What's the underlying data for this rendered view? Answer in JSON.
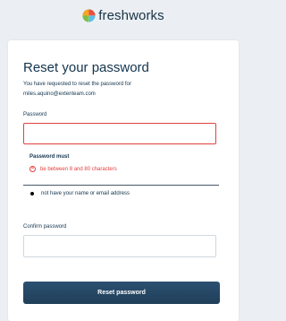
{
  "brand": {
    "name": "freshworks",
    "colors": [
      "#f5a623",
      "#e94e3d",
      "#2aa8e0",
      "#7cbf42"
    ]
  },
  "card": {
    "title": "Reset your password",
    "subtitle_line1": "You have requested to reset the password for",
    "subtitle_line2": "miles.aquino@extenteam.com"
  },
  "password": {
    "label": "Password",
    "value": "",
    "state": "error"
  },
  "rules": {
    "title": "Password must",
    "items": [
      {
        "text": "be between 8 and 80 characters",
        "status": "failed",
        "icon": "x-circle-icon"
      },
      {
        "text": "not have your name or email address",
        "status": "neutral",
        "icon": "bullet-icon"
      }
    ]
  },
  "confirm_password": {
    "label": "Confirm password",
    "value": ""
  },
  "submit": {
    "label": "Reset password",
    "color": "#264966"
  },
  "colors": {
    "background": "#ebeff3",
    "error": "#e3403f",
    "text": "#12344d"
  }
}
